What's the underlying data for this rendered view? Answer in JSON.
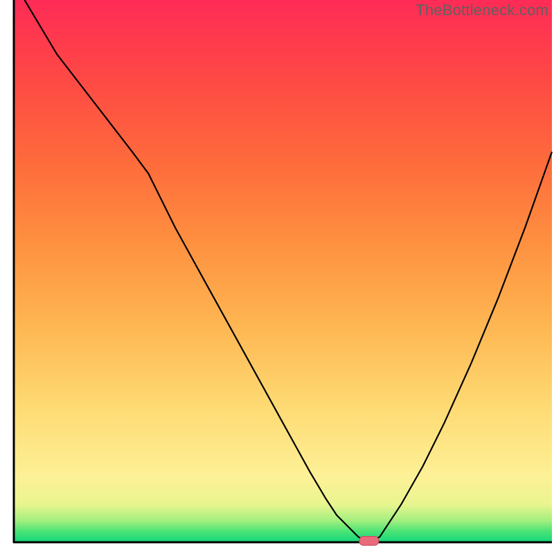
{
  "watermark": "TheBottleneck.com",
  "chart_data": {
    "type": "line",
    "title": "",
    "xlabel": "",
    "ylabel": "",
    "xlim": [
      0,
      100
    ],
    "ylim": [
      0,
      100
    ],
    "x": [
      2,
      8,
      15,
      22,
      25,
      30,
      35,
      40,
      45,
      50,
      55,
      58,
      60,
      62,
      64,
      66,
      68,
      72,
      76,
      80,
      85,
      90,
      95,
      100
    ],
    "values": [
      100,
      90,
      81,
      72,
      68,
      58,
      49,
      40,
      31,
      22,
      13,
      8,
      5,
      3,
      1,
      0,
      1,
      7,
      14,
      22,
      33,
      45,
      58,
      72
    ],
    "optimal_x": 66,
    "optimal_y": 0,
    "gradient_stops": [
      {
        "offset": 0.0,
        "color": "#12d77a"
      },
      {
        "offset": 0.02,
        "color": "#4be376"
      },
      {
        "offset": 0.04,
        "color": "#a4ef7f"
      },
      {
        "offset": 0.07,
        "color": "#e9f58f"
      },
      {
        "offset": 0.12,
        "color": "#fdf197"
      },
      {
        "offset": 0.25,
        "color": "#feda73"
      },
      {
        "offset": 0.4,
        "color": "#feb652"
      },
      {
        "offset": 0.55,
        "color": "#fe9140"
      },
      {
        "offset": 0.7,
        "color": "#fe6b3c"
      },
      {
        "offset": 0.85,
        "color": "#fe4a44"
      },
      {
        "offset": 1.0,
        "color": "#fe2b56"
      }
    ],
    "marker": {
      "color_fill": "#e96a7a",
      "color_stroke": "#c94858"
    }
  },
  "axes": {
    "stroke": "#000000",
    "width": 3
  }
}
